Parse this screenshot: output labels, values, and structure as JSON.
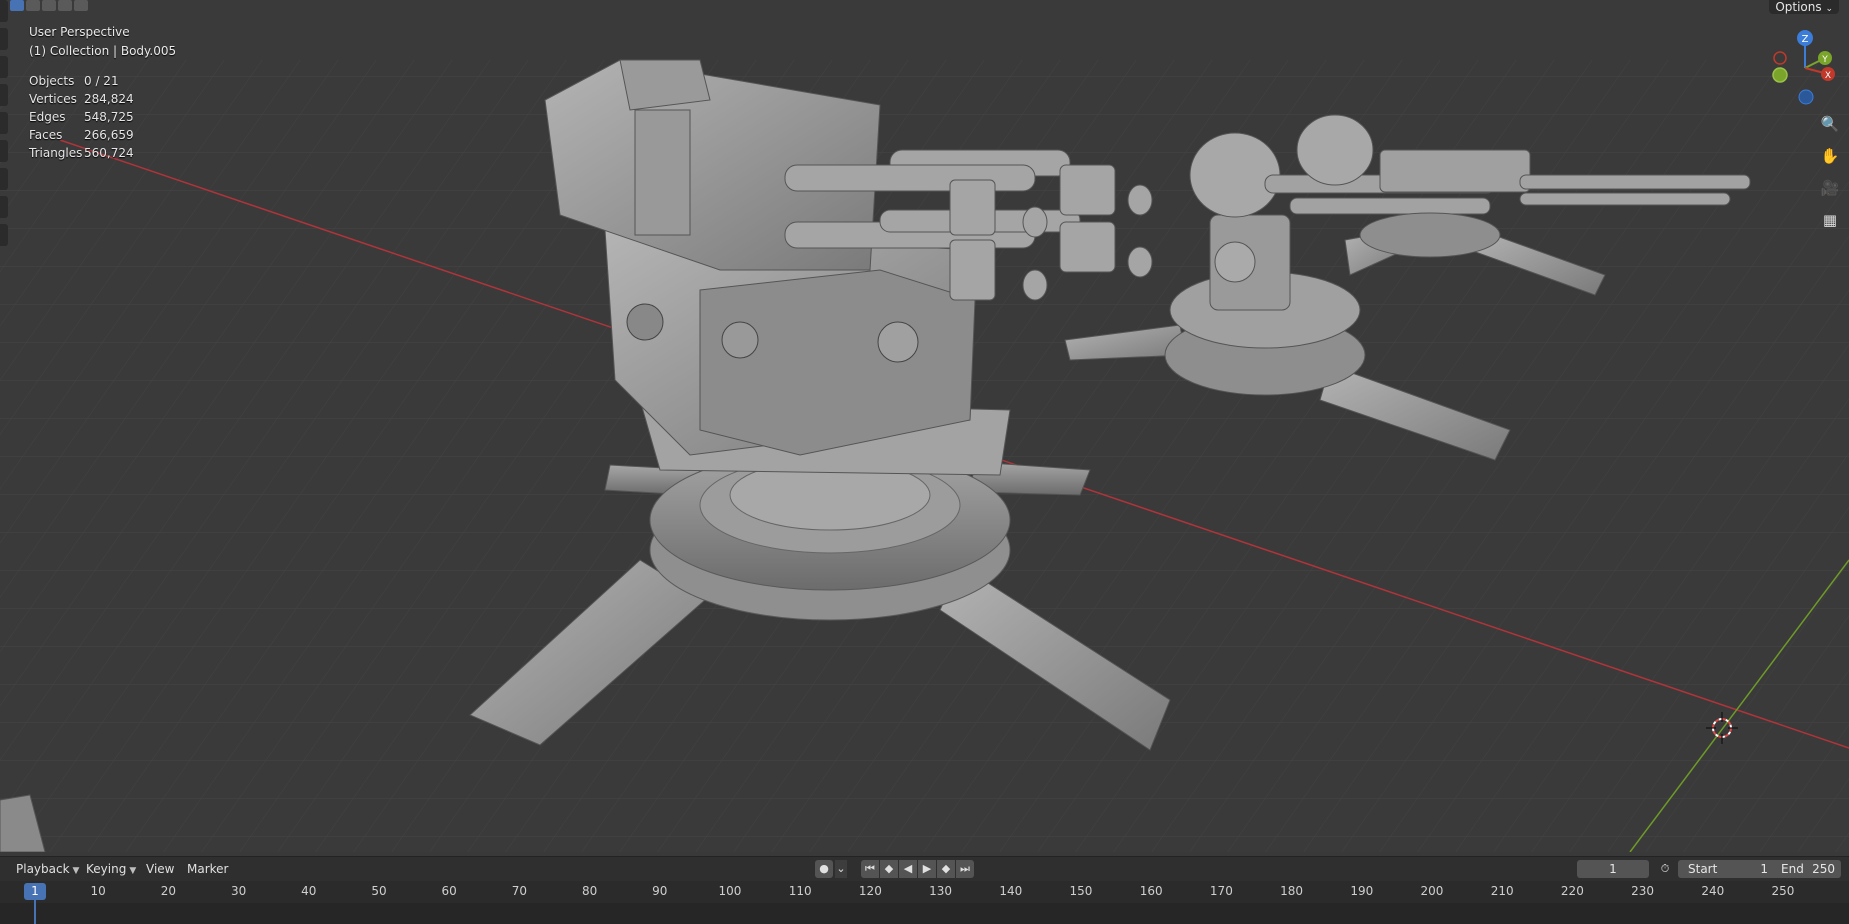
{
  "viewport": {
    "view_name": "User Perspective",
    "collection": "(1) Collection | Body.005",
    "options_label": "Options",
    "stats": [
      {
        "label": "Objects",
        "value": "0 / 21"
      },
      {
        "label": "Vertices",
        "value": "284,824"
      },
      {
        "label": "Edges",
        "value": "548,725"
      },
      {
        "label": "Faces",
        "value": "266,659"
      },
      {
        "label": "Triangles",
        "value": "560,724"
      }
    ],
    "gizmo": {
      "z": "Z",
      "y": "Y",
      "x": "X"
    },
    "axis_colors": {
      "x": "#c0392b",
      "y": "#7aa52a",
      "z": "#3b7dd8"
    }
  },
  "timeline": {
    "menus": {
      "playback": "Playback",
      "keying": "Keying",
      "view": "View",
      "marker": "Marker"
    },
    "current_frame": "1",
    "start_label": "Start",
    "start_value": "1",
    "end_label": "End",
    "end_value": "250",
    "ruler_current": "1",
    "ruler_ticks": [
      "10",
      "20",
      "30",
      "40",
      "50",
      "60",
      "70",
      "80",
      "90",
      "100",
      "110",
      "120",
      "130",
      "140",
      "150",
      "160",
      "170",
      "180",
      "190",
      "200",
      "210",
      "220",
      "230",
      "240",
      "250"
    ]
  },
  "colors": {
    "accent": "#4772b3",
    "bg": "#3a3a3a",
    "model": "#9a9a9a"
  }
}
